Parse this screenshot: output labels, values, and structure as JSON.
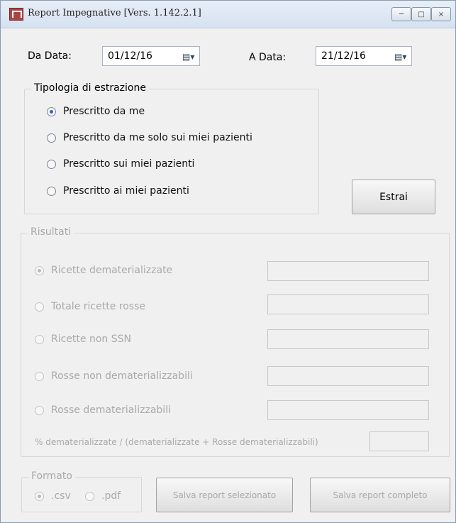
{
  "window": {
    "title": "Report Impegnative [Vers. 1.142.2.1]"
  },
  "controls": {
    "minimize": "─",
    "maximize": "□",
    "close": "×"
  },
  "dates": {
    "from_label": "Da Data:",
    "from_value": "01/12/16",
    "to_label": "A Data:",
    "to_value": "21/12/16"
  },
  "extraction": {
    "legend": "Tipologia di estrazione",
    "options": [
      "Prescritto da me",
      "Prescritto da me solo sui miei pazienti",
      "Prescritto sui miei pazienti",
      "Prescritto ai miei pazienti"
    ],
    "selected": 0
  },
  "buttons": {
    "extract": "Estrai",
    "save_selected": "Salva report selezionato",
    "save_full": "Salva report completo"
  },
  "results": {
    "legend": "Risultati",
    "options": [
      "Ricette dematerializzate",
      "Totale ricette rosse",
      "Ricette non SSN",
      "Rosse non dematerializzabili",
      "Rosse dematerializzabili"
    ],
    "ratio_label": "% dematerializzate / (dematerializzate + Rosse dematerializzabili)"
  },
  "format": {
    "legend": "Formato",
    "csv": ".csv",
    "pdf": ".pdf"
  }
}
